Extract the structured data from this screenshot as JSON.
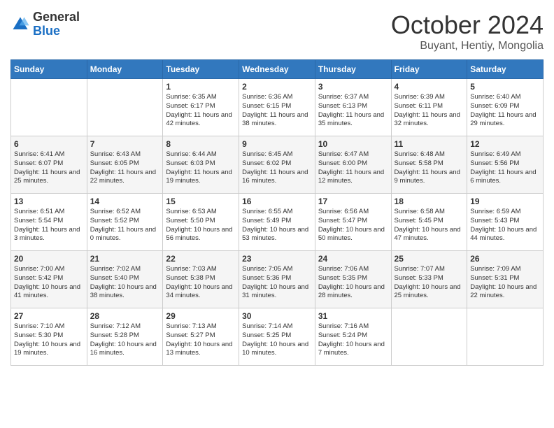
{
  "header": {
    "logo_general": "General",
    "logo_blue": "Blue",
    "month_title": "October 2024",
    "location": "Buyant, Hentiy, Mongolia"
  },
  "days_of_week": [
    "Sunday",
    "Monday",
    "Tuesday",
    "Wednesday",
    "Thursday",
    "Friday",
    "Saturday"
  ],
  "weeks": [
    [
      {
        "day": "",
        "content": ""
      },
      {
        "day": "",
        "content": ""
      },
      {
        "day": "1",
        "content": "Sunrise: 6:35 AM\nSunset: 6:17 PM\nDaylight: 11 hours and 42 minutes."
      },
      {
        "day": "2",
        "content": "Sunrise: 6:36 AM\nSunset: 6:15 PM\nDaylight: 11 hours and 38 minutes."
      },
      {
        "day": "3",
        "content": "Sunrise: 6:37 AM\nSunset: 6:13 PM\nDaylight: 11 hours and 35 minutes."
      },
      {
        "day": "4",
        "content": "Sunrise: 6:39 AM\nSunset: 6:11 PM\nDaylight: 11 hours and 32 minutes."
      },
      {
        "day": "5",
        "content": "Sunrise: 6:40 AM\nSunset: 6:09 PM\nDaylight: 11 hours and 29 minutes."
      }
    ],
    [
      {
        "day": "6",
        "content": "Sunrise: 6:41 AM\nSunset: 6:07 PM\nDaylight: 11 hours and 25 minutes."
      },
      {
        "day": "7",
        "content": "Sunrise: 6:43 AM\nSunset: 6:05 PM\nDaylight: 11 hours and 22 minutes."
      },
      {
        "day": "8",
        "content": "Sunrise: 6:44 AM\nSunset: 6:03 PM\nDaylight: 11 hours and 19 minutes."
      },
      {
        "day": "9",
        "content": "Sunrise: 6:45 AM\nSunset: 6:02 PM\nDaylight: 11 hours and 16 minutes."
      },
      {
        "day": "10",
        "content": "Sunrise: 6:47 AM\nSunset: 6:00 PM\nDaylight: 11 hours and 12 minutes."
      },
      {
        "day": "11",
        "content": "Sunrise: 6:48 AM\nSunset: 5:58 PM\nDaylight: 11 hours and 9 minutes."
      },
      {
        "day": "12",
        "content": "Sunrise: 6:49 AM\nSunset: 5:56 PM\nDaylight: 11 hours and 6 minutes."
      }
    ],
    [
      {
        "day": "13",
        "content": "Sunrise: 6:51 AM\nSunset: 5:54 PM\nDaylight: 11 hours and 3 minutes."
      },
      {
        "day": "14",
        "content": "Sunrise: 6:52 AM\nSunset: 5:52 PM\nDaylight: 11 hours and 0 minutes."
      },
      {
        "day": "15",
        "content": "Sunrise: 6:53 AM\nSunset: 5:50 PM\nDaylight: 10 hours and 56 minutes."
      },
      {
        "day": "16",
        "content": "Sunrise: 6:55 AM\nSunset: 5:49 PM\nDaylight: 10 hours and 53 minutes."
      },
      {
        "day": "17",
        "content": "Sunrise: 6:56 AM\nSunset: 5:47 PM\nDaylight: 10 hours and 50 minutes."
      },
      {
        "day": "18",
        "content": "Sunrise: 6:58 AM\nSunset: 5:45 PM\nDaylight: 10 hours and 47 minutes."
      },
      {
        "day": "19",
        "content": "Sunrise: 6:59 AM\nSunset: 5:43 PM\nDaylight: 10 hours and 44 minutes."
      }
    ],
    [
      {
        "day": "20",
        "content": "Sunrise: 7:00 AM\nSunset: 5:42 PM\nDaylight: 10 hours and 41 minutes."
      },
      {
        "day": "21",
        "content": "Sunrise: 7:02 AM\nSunset: 5:40 PM\nDaylight: 10 hours and 38 minutes."
      },
      {
        "day": "22",
        "content": "Sunrise: 7:03 AM\nSunset: 5:38 PM\nDaylight: 10 hours and 34 minutes."
      },
      {
        "day": "23",
        "content": "Sunrise: 7:05 AM\nSunset: 5:36 PM\nDaylight: 10 hours and 31 minutes."
      },
      {
        "day": "24",
        "content": "Sunrise: 7:06 AM\nSunset: 5:35 PM\nDaylight: 10 hours and 28 minutes."
      },
      {
        "day": "25",
        "content": "Sunrise: 7:07 AM\nSunset: 5:33 PM\nDaylight: 10 hours and 25 minutes."
      },
      {
        "day": "26",
        "content": "Sunrise: 7:09 AM\nSunset: 5:31 PM\nDaylight: 10 hours and 22 minutes."
      }
    ],
    [
      {
        "day": "27",
        "content": "Sunrise: 7:10 AM\nSunset: 5:30 PM\nDaylight: 10 hours and 19 minutes."
      },
      {
        "day": "28",
        "content": "Sunrise: 7:12 AM\nSunset: 5:28 PM\nDaylight: 10 hours and 16 minutes."
      },
      {
        "day": "29",
        "content": "Sunrise: 7:13 AM\nSunset: 5:27 PM\nDaylight: 10 hours and 13 minutes."
      },
      {
        "day": "30",
        "content": "Sunrise: 7:14 AM\nSunset: 5:25 PM\nDaylight: 10 hours and 10 minutes."
      },
      {
        "day": "31",
        "content": "Sunrise: 7:16 AM\nSunset: 5:24 PM\nDaylight: 10 hours and 7 minutes."
      },
      {
        "day": "",
        "content": ""
      },
      {
        "day": "",
        "content": ""
      }
    ]
  ]
}
